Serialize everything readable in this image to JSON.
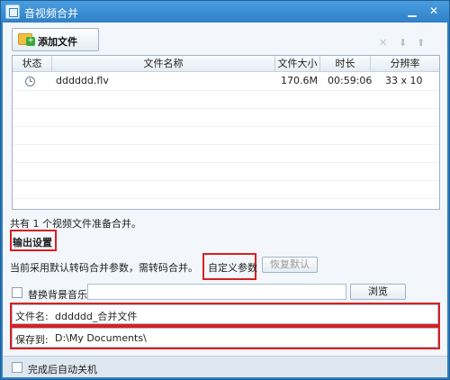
{
  "window": {
    "title": "音视频合并",
    "minimize": "▁",
    "close": "✕"
  },
  "toolbar": {
    "add_file_label": "添加文件",
    "icons": [
      "delete-icon",
      "move-down-icon",
      "move-up-icon"
    ]
  },
  "file_list": {
    "columns": [
      "状态",
      "文件名称",
      "文件大小",
      "时长",
      "分辨率"
    ],
    "rows": [
      {
        "status_icon": "clock-icon",
        "name": "dddddd.flv",
        "size": "170.6M",
        "duration": "00:59:06",
        "resolution": "33 x 10"
      }
    ]
  },
  "summary_text": "共有 1 个视频文件准备合并。",
  "output": {
    "section_title": "输出设置",
    "param_text": "当前采用默认转码合并参数，需转码合并。",
    "custom_params_label": "自定义参数",
    "restore_default_label": "恢复默认",
    "bg_music_label": "替换背景音乐",
    "browse_label": "浏览",
    "filename_label": "文件名:",
    "filename_value": "dddddd_合并文件",
    "saveto_label": "保存到:",
    "saveto_value": "D:\\My Documents\\"
  },
  "footer": {
    "shutdown_label": "完成后自动关机"
  },
  "colors": {
    "highlight": "#d92020",
    "titlebar": "#2f80c8"
  }
}
